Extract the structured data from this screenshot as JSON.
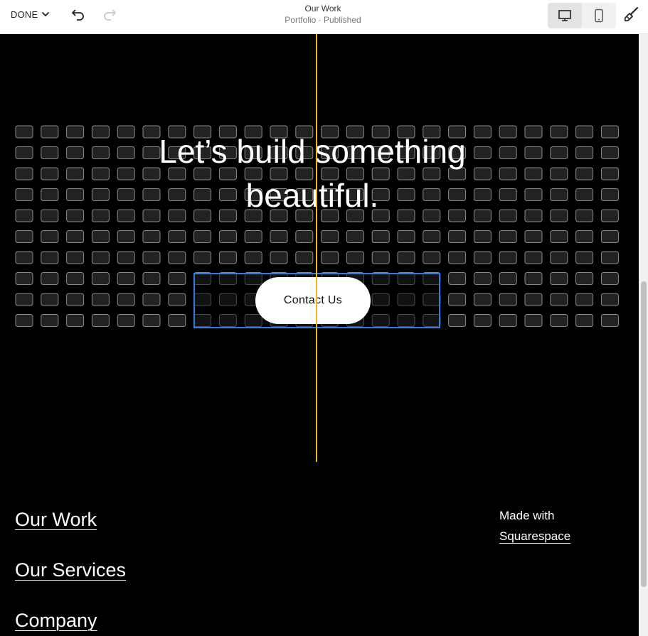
{
  "toolbar": {
    "done_label": "DONE",
    "page_title": "Our Work",
    "page_subtitle": "Portfolio · Published",
    "icons": [
      "chevron-down-icon",
      "undo-icon",
      "redo-icon",
      "desktop-icon",
      "mobile-icon",
      "paintbrush-icon"
    ],
    "active_device": "desktop"
  },
  "hero": {
    "headline_line1": "Let’s build something",
    "headline_line2": "beautiful.",
    "cta_label": "Contact Us"
  },
  "footer": {
    "links": [
      "Our Work",
      "Our Services",
      "Company"
    ],
    "made_with": "Made with",
    "squarespace": "Squarespace"
  },
  "colors": {
    "background": "#000000",
    "guide_line": "#f3b51c",
    "selection": "#2f7de1",
    "grid_cell_stroke": "#8a8a8a",
    "grid_cell_fill": "#222222"
  }
}
